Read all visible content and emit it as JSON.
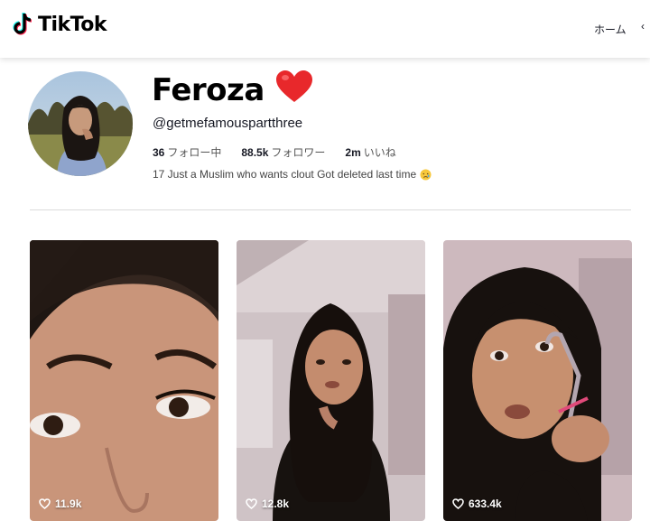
{
  "header": {
    "logo_text": "TikTok",
    "nav_home": "ホーム",
    "nav_more": "‹"
  },
  "profile": {
    "display_name": "Feroza",
    "username": "@getmefamouspartthree",
    "stats": [
      {
        "value": "36",
        "label": "フォロー中"
      },
      {
        "value": "88.5k",
        "label": "フォロワー"
      },
      {
        "value": "2m",
        "label": "いいね"
      }
    ],
    "bio": "17 Just a Muslim who wants clout Got deleted last time"
  },
  "videos": [
    {
      "likes": "11.9k"
    },
    {
      "likes": "12.8k"
    },
    {
      "likes": "633.4k"
    }
  ],
  "colors": {
    "heart": "#e8282b",
    "divider": "#dcdcdc"
  }
}
